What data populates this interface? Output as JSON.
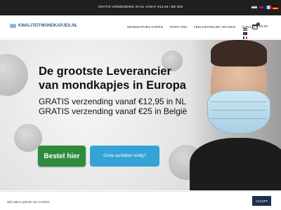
{
  "topbar": {
    "promo": "GRATIS VERZENDING IN NL VANAF €12,95 / BE €25",
    "flags": [
      "nl",
      "gb",
      "fr",
      "de"
    ]
  },
  "header": {
    "logo_text": "KWALITEITMONDKAPJES.NL",
    "nav": [
      "MONDKAPJES KOPEN",
      "OVER ONS",
      "VEELGESTELDE VRAGEN",
      "CONTACT"
    ],
    "cart_count": "0",
    "cart_total": "€0,00"
  },
  "hero": {
    "headline": "De grootste Leverancier van mondkapjes in Europa",
    "line1": "GRATIS verzending vanaf €12,95 in NL",
    "line2": "GRATIS verzending vanaf €25 in België",
    "order_button": "Bestel hier",
    "bulk_button": "Grote aantallen nodig?"
  },
  "cookie": {
    "text": "Wij maken gebruik van Cookies.",
    "accept": "ACCEPT"
  },
  "colors": {
    "order_button": "#2e8b3d",
    "bulk_button": "#33a3d8",
    "topbar": "#1f1f1f",
    "accept": "#1d2f4a"
  }
}
